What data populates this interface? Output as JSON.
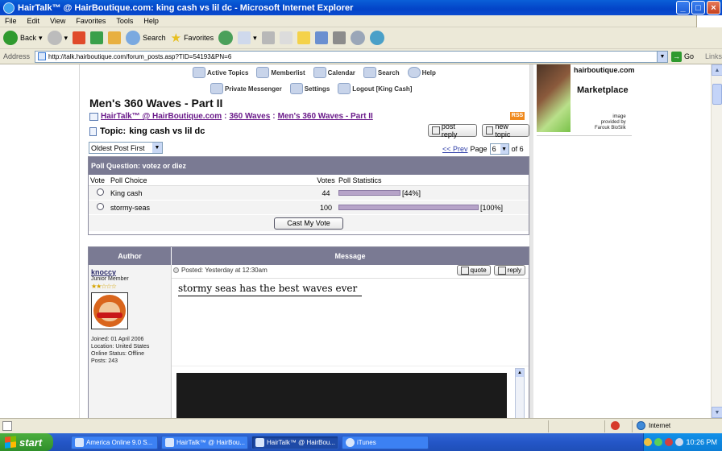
{
  "window": {
    "title": "HairTalk™ @ HairBoutique.com: king cash vs lil dc - Microsoft Internet Explorer"
  },
  "menu": [
    "File",
    "Edit",
    "View",
    "Favorites",
    "Tools",
    "Help"
  ],
  "toolbar": {
    "back": "Back",
    "search": "Search",
    "favorites": "Favorites"
  },
  "address": {
    "label": "Address",
    "url": "http://talk.hairboutique.com/forum_posts.asp?TID=54193&PN=6",
    "go": "Go",
    "links": "Links"
  },
  "forum_nav": {
    "active_topics": "Active Topics",
    "memberlist": "Memberlist",
    "calendar": "Calendar",
    "search": "Search",
    "help": "Help",
    "private_messenger": "Private Messenger",
    "settings": "Settings",
    "logout": "Logout [King Cash]"
  },
  "forum": {
    "title": "Men's 360 Waves - Part II",
    "breadcrumb": {
      "home": "HairTalk™ @ HairBoutique.com",
      "sep1": ":",
      "cat": "360 Waves",
      "sep2": ":",
      "forum": "Men's 360 Waves - Part II"
    },
    "rss": "RSS",
    "topic_prefix": "Topic:",
    "topic": "king cash vs lil dc",
    "post_reply": "post reply",
    "new_topic": "new topic",
    "sort": "Oldest Post First",
    "pager": {
      "prev": "<< Prev",
      "page_label": "Page",
      "current": "6",
      "of_label": "of 6"
    }
  },
  "poll": {
    "question": "Poll Question: votez or diez",
    "col_vote": "Vote",
    "col_choice": "Poll Choice",
    "col_votes": "Votes",
    "col_stats": "Poll Statistics",
    "choices": [
      {
        "label": "King cash",
        "votes": "44",
        "percent_label": "[44%]",
        "percent": 44
      },
      {
        "label": "stormy-seas",
        "votes": "100",
        "percent_label": "[100%]",
        "percent": 100
      }
    ],
    "cast_button": "Cast My Vote"
  },
  "posts": {
    "col_author": "Author",
    "col_message": "Message",
    "items": [
      {
        "author": "knoccy",
        "rank": "Junior Member",
        "stars": "★★☆☆☆",
        "joined": "Joined: 01 April 2006",
        "location": "Location: United States",
        "online": "Online Status: Offline",
        "post_count": "Posts: 243",
        "posted": "Posted: Yesterday at 12:30am",
        "quote": "quote",
        "reply": "reply",
        "message": "stormy seas has the best waves ever"
      }
    ]
  },
  "ad": {
    "site": "hairboutique.com",
    "title": "Marketplace",
    "credit_line1": "image",
    "credit_line2": "provided by",
    "credit_line3": "Farouk BioSilk"
  },
  "status": {
    "zone": "Internet"
  },
  "taskbar": {
    "start": "start",
    "tasks": [
      "America Online 9.0 S...",
      "HairTalk™ @ HairBou...",
      "HairTalk™ @ HairBou...",
      "iTunes"
    ],
    "clock": "10:26 PM"
  },
  "colors": {
    "titlebar": "#0343c7",
    "table_header": "#7a7a93",
    "link_purple": "#6a1a8a",
    "poll_bar": "#b6a3c8"
  }
}
